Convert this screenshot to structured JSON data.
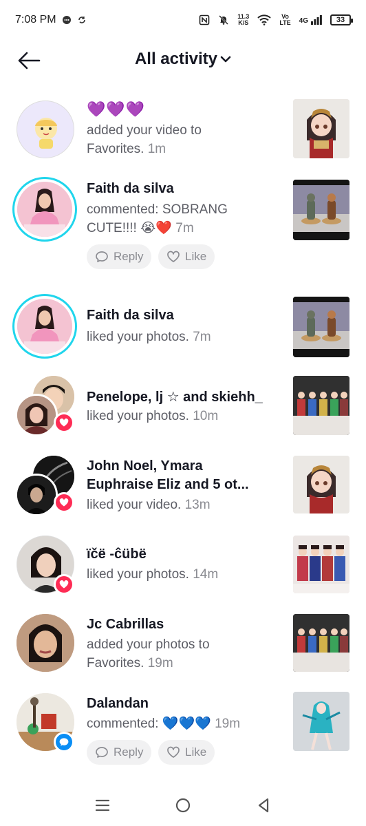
{
  "status_bar": {
    "time": "7:08 PM",
    "net_speed_value": "11.3",
    "net_speed_unit": "K/S",
    "volte": "Vo",
    "lte": "LTE",
    "network": "4G",
    "battery": "33"
  },
  "header": {
    "title": "All activity"
  },
  "activities": [
    {
      "name": "💜💜💜",
      "desc_lines": [
        "added your video to",
        "Favorites."
      ],
      "time": "1m"
    },
    {
      "name": "Faith da silva",
      "desc_lines": [
        "commented: SOBRANG",
        "CUTE!!!! 😭❤️"
      ],
      "time": "7m",
      "reply_label": "Reply",
      "like_label": "Like"
    },
    {
      "name": "Faith da silva",
      "desc_lines": [
        "liked your photos."
      ],
      "time": "7m"
    },
    {
      "name": "Penelope, lj ☆ and skiehh_",
      "desc_lines": [
        "liked your photos."
      ],
      "time": "10m"
    },
    {
      "name_lines": [
        "John Noel, Ymara",
        "Euphraise Eliz and 5 ot..."
      ],
      "desc_lines": [
        "liked your video."
      ],
      "time": "13m"
    },
    {
      "name": "ïčë -ĉübë",
      "desc_lines": [
        "liked your photos."
      ],
      "time": "14m"
    },
    {
      "name": "Jc Cabrillas",
      "desc_lines": [
        "added your photos to",
        "Favorites."
      ],
      "time": "19m"
    },
    {
      "name": "Dalandan",
      "desc_lines": [
        "commented: 💙💙💙"
      ],
      "time": "19m",
      "reply_label": "Reply",
      "like_label": "Like"
    }
  ],
  "colors": {
    "ring": "#20d5ec",
    "heart_badge": "#fe2c55",
    "comment_badge": "#0a8ef5",
    "secondary_text": "#5d5e66"
  }
}
